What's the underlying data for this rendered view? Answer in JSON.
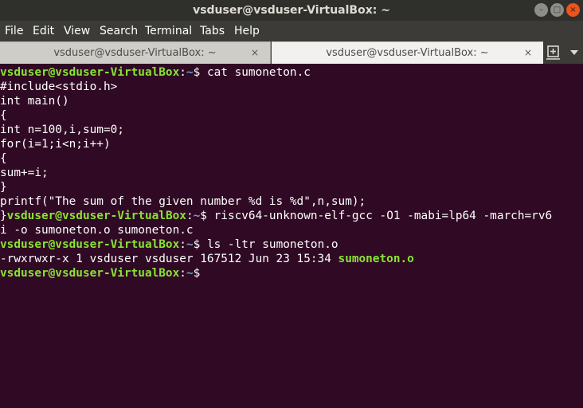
{
  "window": {
    "title": "vsduser@vsduser-VirtualBox: ~",
    "controls": {
      "minimize": "–",
      "maximize": "□",
      "close": "×"
    }
  },
  "menu": [
    "File",
    "Edit",
    "View",
    "Search",
    "Terminal",
    "Tabs",
    "Help"
  ],
  "tabs": [
    {
      "label": "vsduser@vsduser-VirtualBox: ~",
      "active": false,
      "close": "×"
    },
    {
      "label": "vsduser@vsduser-VirtualBox: ~",
      "active": true,
      "close": "×"
    }
  ],
  "tab_controls": {
    "new_tab_icon": "new-tab-icon",
    "menu_icon": "chevron-down-icon"
  },
  "colors": {
    "terminal_bg": "#300a24",
    "prompt_user": "#8ae234",
    "prompt_path": "#729fcf",
    "text": "#ffffff"
  },
  "prompt": {
    "user": "vsduser@vsduser-VirtualBox",
    "colon": ":",
    "path": "~",
    "symbol": "$"
  },
  "terminal": {
    "cmd1": " cat sumoneton.c",
    "code": [
      "#include<stdio.h>",
      "int main()",
      "{",
      "int n=100,i,sum=0;",
      "for(i=1;i<n;i++)",
      "{",
      "sum+=i;",
      "}",
      "printf(\"The sum of the given number %d is %d\",n,sum);"
    ],
    "code_end": "}",
    "cmd2": " riscv64-unknown-elf-gcc -O1 -mabi=lp64 -march=rv6",
    "cmd2_wrap": "i -o sumoneton.o sumoneton.c",
    "cmd3": " ls -ltr sumoneton.o",
    "ls_output": "-rwxrwxr-x 1 vsduser vsduser 167512 Jun 23 15:34 ",
    "ls_file": "sumoneton.o"
  }
}
